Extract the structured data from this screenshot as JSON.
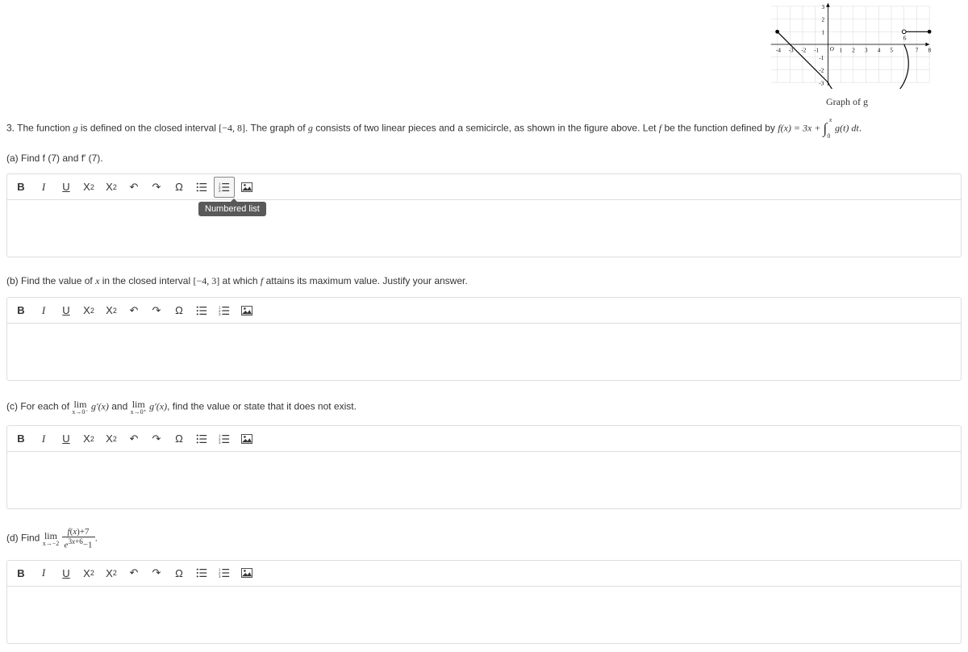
{
  "graph": {
    "caption": "Graph of g",
    "x_ticks": [
      "-4",
      "-3",
      "-2",
      "-1",
      "1",
      "2",
      "3",
      "4",
      "5",
      "7",
      "8"
    ],
    "origin_label": "O",
    "y_ticks_pos": [
      "1",
      "2",
      "3"
    ],
    "y_ticks_neg": [
      "-1",
      "-2",
      "-3"
    ],
    "extra_label": "6"
  },
  "problem": {
    "intro_a": "3. The function ",
    "intro_b": " is defined on the closed interval ",
    "interval_main": "[−4, 8]",
    "intro_c": ". The graph of ",
    "intro_d": " consists of two linear pieces and a semicircle, as shown in the figure above. Let ",
    "intro_e": " be the function defined by ",
    "eq_lhs": "f(x) = 3x + ",
    "eq_int_dt": " g(t) dt",
    "period": "."
  },
  "parts": {
    "a": "(a) Find f (7) and f′ (7).",
    "b_a": "(b) Find the value of ",
    "b_b": " in the closed interval ",
    "b_interval": "[−4, 3]",
    "b_c": " at which ",
    "b_d": " attains its maximum value. Justify your answer.",
    "c_a": "(c) For each of ",
    "c_b": " and ",
    "c_c": ", find the value or state that it does not exist.",
    "c_lim1_under": "x→0⁻",
    "c_lim2_under": "x→0⁺",
    "c_func": "g′(x)",
    "d_a": "(d) Find ",
    "d_lim_under": "x→−2",
    "d_num": "f(x)+7",
    "d_den": "e^{3x+6}−1",
    "d_period": "."
  },
  "toolbar": {
    "bold": "B",
    "italic": "I",
    "underline": "U",
    "sup": "X",
    "sub": "X",
    "undo": "↶",
    "redo": "↷",
    "omega": "Ω",
    "ul": "bullet-list",
    "ol": "numbered-list",
    "img": "image"
  },
  "tooltip": {
    "numbered_list": "Numbered list"
  },
  "chart_data": {
    "type": "line",
    "title": "Graph of g",
    "xlabel": "",
    "ylabel": "",
    "xlim": [
      -4,
      8
    ],
    "ylim": [
      -3,
      3
    ],
    "segments": [
      {
        "type": "line",
        "from": [
          -4,
          1
        ],
        "to": [
          0,
          -3
        ]
      },
      {
        "type": "semicircle",
        "center": [
          3,
          0
        ],
        "radius": 3,
        "from": [
          0,
          -3
        ],
        "to": [
          6,
          0
        ],
        "orientation": "below_then_up"
      },
      {
        "type": "line",
        "from": [
          6,
          1
        ],
        "to": [
          8,
          1
        ],
        "open_start": true,
        "closed_end": true
      }
    ],
    "x_ticks": [
      -4,
      -3,
      -2,
      -1,
      0,
      1,
      2,
      3,
      4,
      5,
      6,
      7,
      8
    ],
    "y_ticks": [
      -3,
      -2,
      -1,
      0,
      1,
      2,
      3
    ]
  }
}
